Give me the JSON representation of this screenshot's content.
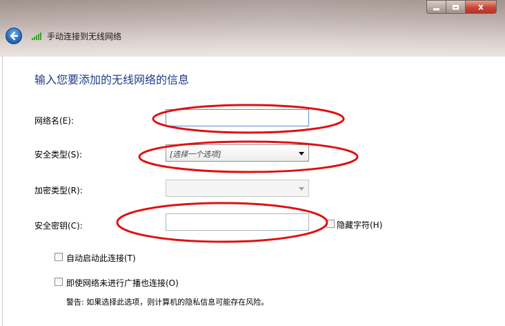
{
  "window": {
    "title": "手动连接到无线网络",
    "controls": {
      "minimize": "",
      "maximize": "",
      "close": "x"
    }
  },
  "form": {
    "heading": "输入您要添加的无线网络的信息",
    "network_name": {
      "label": "网络名(E):",
      "value": ""
    },
    "security_type": {
      "label": "安全类型(S):",
      "selected": "[选择一个选项]"
    },
    "encryption_type": {
      "label": "加密类型(R):",
      "selected": ""
    },
    "security_key": {
      "label": "安全密钥(C):",
      "value": "",
      "hide_chars_label": "隐藏字符(H)"
    },
    "auto_start": {
      "label": "自动启动此连接(T)",
      "checked": false
    },
    "connect_hidden": {
      "label": "即使网络未进行广播也连接(O)",
      "checked": false
    },
    "warning": "警告: 如果选择此选项，则计算机的隐私信息可能存在风险。"
  },
  "colors": {
    "heading": "#1e3b8a",
    "annotation": "#e01010",
    "close_button": "#c7473a"
  },
  "icons": [
    "back-arrow-icon",
    "wireless-signal-icon",
    "minimize-icon",
    "maximize-icon",
    "close-icon",
    "dropdown-caret-icon"
  ]
}
